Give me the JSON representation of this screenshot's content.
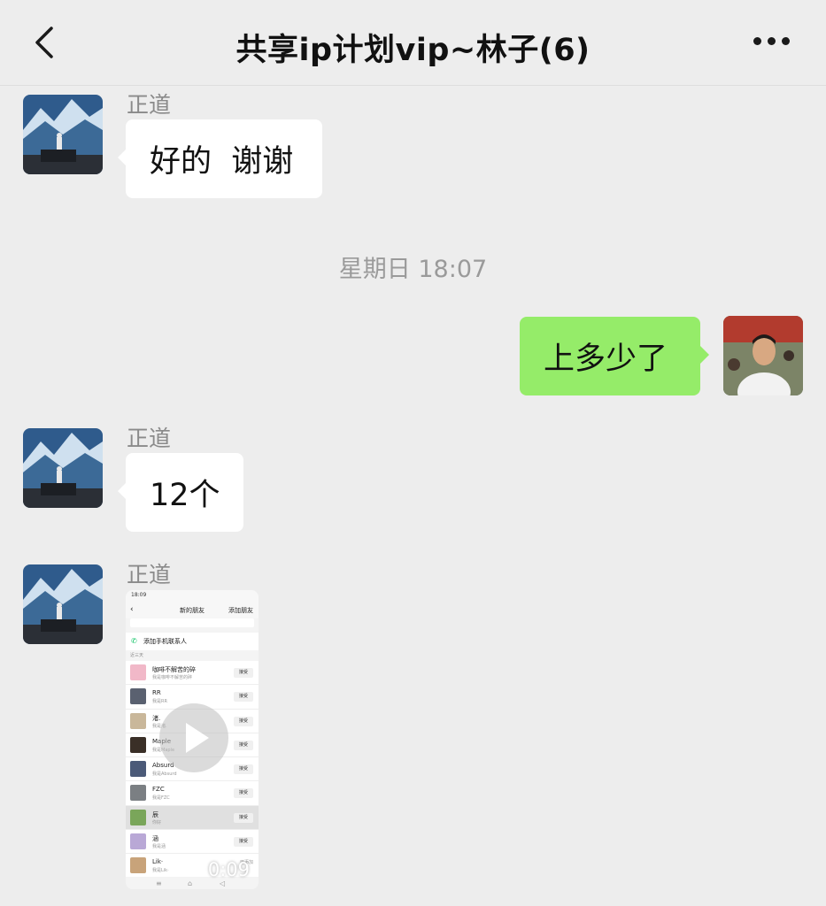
{
  "header": {
    "title": "共享ip计划vip~林子(6)",
    "back_icon": "chevron-left-icon",
    "more_icon": "more-dots-icon"
  },
  "messages": [
    {
      "direction": "incoming",
      "sender": "正道",
      "type": "text",
      "text": "好的  谢谢"
    },
    {
      "type": "timestamp",
      "text": "星期日 18:07"
    },
    {
      "direction": "outgoing",
      "type": "text",
      "text": "上多少了"
    },
    {
      "direction": "incoming",
      "sender": "正道",
      "type": "text",
      "text": "12个"
    },
    {
      "direction": "incoming",
      "sender": "正道",
      "type": "video",
      "duration": "0:09",
      "thumbnail": {
        "status_time": "18:09",
        "title": "新的朋友",
        "right_action": "添加朋友",
        "add_contacts": "添加手机联系人",
        "section": "近三天",
        "rows": [
          {
            "name": "咖啡不解苦的碎",
            "sub": "我是咖啡不解苦的碎",
            "action": "接受"
          },
          {
            "name": "RR",
            "sub": "我是RR",
            "action": "接受"
          },
          {
            "name": "渚.",
            "sub": "我是渚.",
            "action": "接受"
          },
          {
            "name": "Maple",
            "sub": "我是Maple",
            "action": "接受"
          },
          {
            "name": "Absurd",
            "sub": "我是Absurd",
            "action": "接受"
          },
          {
            "name": "FZC",
            "sub": "我是FZC",
            "action": "接受"
          },
          {
            "name": "辰",
            "sub": "你好",
            "action": "接受"
          },
          {
            "name": "涵",
            "sub": "我是涵",
            "action": "接受"
          },
          {
            "name": "Lik·",
            "sub": "我是Lik·",
            "action": "已添加"
          }
        ]
      }
    }
  ],
  "colors": {
    "background": "#ededed",
    "incoming_bubble": "#ffffff",
    "outgoing_bubble": "#95ec69",
    "sender_name": "#8a8a8a",
    "timestamp": "#9a9a9a"
  }
}
